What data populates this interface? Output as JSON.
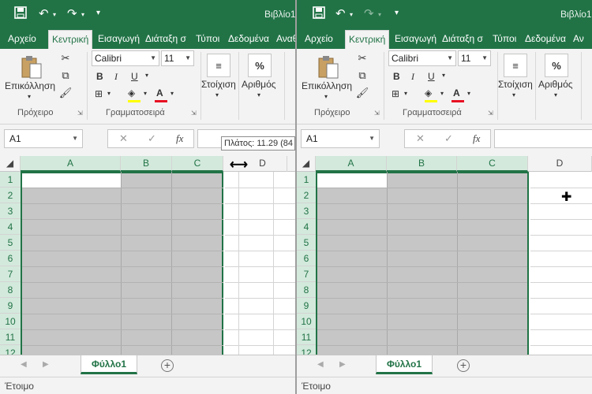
{
  "window": {
    "title": "Βιβλίο1"
  },
  "qat": {
    "save_icon": "save-icon",
    "undo_icon": "undo-icon",
    "redo_icon": "redo-icon",
    "customize_icon": "customize-icon"
  },
  "tabs_left": [
    "Αρχείο",
    "Κεντρική",
    "Εισαγωγή",
    "Διάταξη σ",
    "Τύποι",
    "Δεδομένα",
    "Αναθ"
  ],
  "tabs_right": [
    "Αρχείο",
    "Κεντρική",
    "Εισαγωγή",
    "Διάταξη σ",
    "Τύποι",
    "Δεδομένα",
    "Αν"
  ],
  "ribbon": {
    "paste_label": "Επικόλληση",
    "clipboard_group": "Πρόχειρο",
    "font_name": "Calibri",
    "font_size": "11",
    "font_group": "Γραμματοσειρά",
    "bold": "B",
    "italic": "I",
    "underline": "U",
    "font_color_glyph": "A",
    "alignment_label": "Στοίχιση",
    "number_label": "Αριθμός",
    "number_glyph": "%",
    "font_color": "#e81123",
    "highlight_color": "#ffff00"
  },
  "formula_bar": {
    "name_box": "A1",
    "cancel": "✕",
    "enter": "✓",
    "fx": "fx",
    "value": ""
  },
  "tooltip": {
    "text": "Πλάτος: 11.29 (84"
  },
  "grid": {
    "columns": [
      "A",
      "B",
      "C",
      "D"
    ],
    "rows": [
      "1",
      "2",
      "3",
      "4",
      "5",
      "6",
      "7",
      "8",
      "9",
      "10",
      "11",
      "12"
    ]
  },
  "sheets": {
    "active": "Φύλλο1"
  },
  "status": {
    "text": "Έτοιμο"
  },
  "colors": {
    "accent": "#217346",
    "selection": "#c6c6c6",
    "header_selected": "#d3e9dc"
  }
}
